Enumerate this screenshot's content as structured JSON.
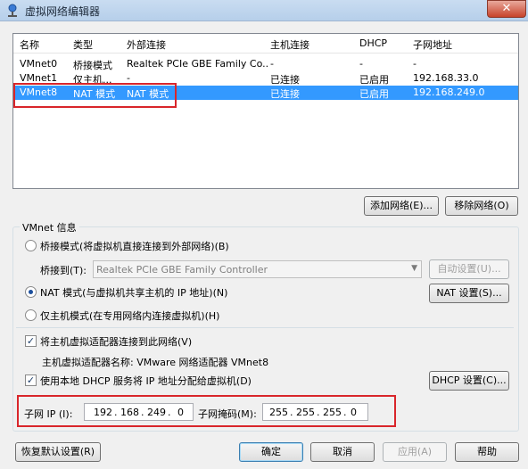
{
  "window": {
    "title": "虚拟网络编辑器",
    "close_symbol": "✕"
  },
  "table": {
    "headers": [
      "名称",
      "类型",
      "外部连接",
      "主机连接",
      "DHCP",
      "子网地址"
    ],
    "rows": [
      {
        "name": "VMnet0",
        "type": "桥接模式",
        "external": "Realtek PCIe GBE Family Co...",
        "host": "-",
        "dhcp": "-",
        "subnet": "-"
      },
      {
        "name": "VMnet1",
        "type": "仅主机...",
        "external": "-",
        "host": "已连接",
        "dhcp": "已启用",
        "subnet": "192.168.33.0"
      },
      {
        "name": "VMnet8",
        "type": "NAT 模式",
        "external": "NAT 模式",
        "host": "已连接",
        "dhcp": "已启用",
        "subnet": "192.168.249.0"
      }
    ],
    "selected_row": 2
  },
  "buttons": {
    "add_network": "添加网络(E)...",
    "remove_network": "移除网络(O)",
    "auto_settings": "自动设置(U)...",
    "nat_settings": "NAT 设置(S)...",
    "dhcp_settings": "DHCP 设置(C)...",
    "restore_defaults": "恢复默认设置(R)",
    "ok": "确定",
    "cancel": "取消",
    "apply": "应用(A)",
    "help": "帮助"
  },
  "vmnet_info": {
    "group_label": "VMnet 信息",
    "bridge_mode": "桥接模式(将虚拟机直接连接到外部网络)(B)",
    "bridge_to_label": "桥接到(T):",
    "bridge_to_value": "Realtek PCIe GBE Family Controller",
    "nat_mode": "NAT 模式(与虚拟机共享主机的 IP 地址)(N)",
    "host_only_mode": "仅主机模式(在专用网络内连接虚拟机)(H)",
    "selected_mode": "nat",
    "connect_adapter": "将主机虚拟适配器连接到此网络(V)",
    "connect_adapter_checked": true,
    "adapter_name": "主机虚拟适配器名称: VMware 网络适配器 VMnet8",
    "use_dhcp": "使用本地 DHCP 服务将 IP 地址分配给虚拟机(D)",
    "use_dhcp_checked": true,
    "subnet_ip_label": "子网 IP (I):",
    "subnet_ip": [
      "192",
      "168",
      "249",
      "0"
    ],
    "subnet_mask_label": "子网掩码(M):",
    "subnet_mask": [
      "255",
      "255",
      "255",
      "0"
    ]
  },
  "colors": {
    "selection": "#3399ff",
    "highlight_box": "#d9262b"
  }
}
